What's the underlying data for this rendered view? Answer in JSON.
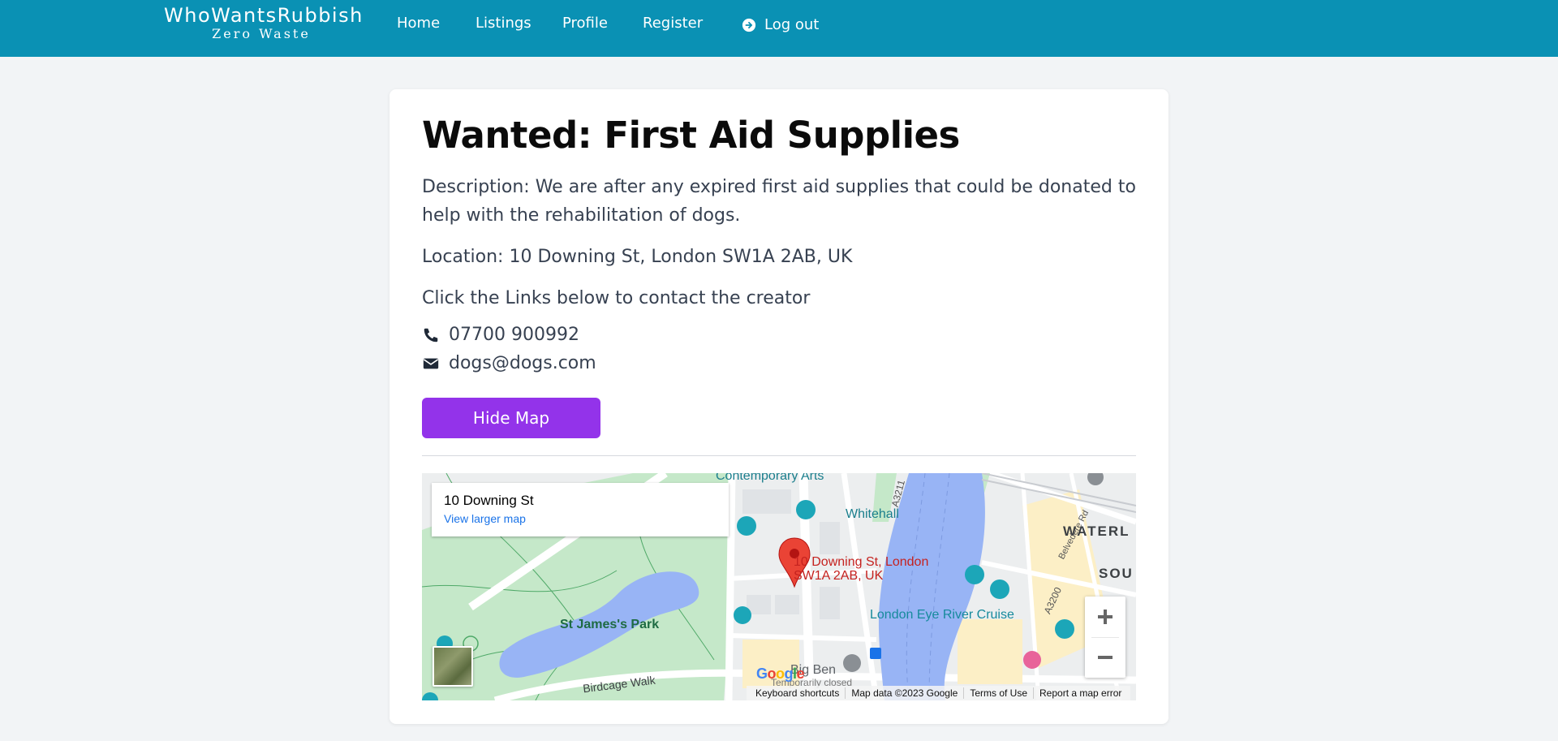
{
  "brand": {
    "name": "WhoWantsRubbish",
    "tagline": "Zero Waste"
  },
  "nav": {
    "home": "Home",
    "listings": "Listings",
    "profile": "Profile",
    "register": "Register",
    "logout": "Log out"
  },
  "listing": {
    "title": "Wanted: First Aid Supplies",
    "description": "Description: We are after any expired first aid supplies that could be donated to help with the rehabilitation of dogs.",
    "location": "Location: 10 Downing St, London SW1A 2AB, UK",
    "contact_hint": "Click the Links below to contact the creator",
    "phone": "07700 900992",
    "email": "dogs@dogs.com",
    "hide_map_label": "Hide Map"
  },
  "map": {
    "info_title": "10 Downing St",
    "info_link": "View larger map",
    "pin_label_line1": "10 Downing St, London",
    "pin_label_line2": "SW1A 2AB, UK",
    "labels": {
      "park": "St James's Park",
      "cruise": "London Eye River Cruise",
      "whitehall": "Whitehall",
      "arts": "Contemporary Arts",
      "big_ben": "Big Ben",
      "closed": "Temporarily closed",
      "birdcage": "Birdcage Walk",
      "waterloo": "WATERL",
      "sou": "SOU",
      "road_a3211": "A3211",
      "road_a3200": "A3200",
      "road_belvedere": "Belvedere Rd"
    },
    "google": "Google",
    "attribution": {
      "shortcuts": "Keyboard shortcuts",
      "data": "Map data ©2023 Google",
      "terms": "Terms of Use",
      "report": "Report a map error"
    },
    "colors": {
      "water": "#98b4f5",
      "park": "#c5e8c9",
      "road": "#ffffff",
      "land": "#eceeef",
      "pin": "#ea4335"
    }
  },
  "colors": {
    "navbar": "#0a91b4",
    "button": "#9333ea",
    "page_bg": "#f2f4f6"
  },
  "icons": {
    "logout": "arrow-circle-right-icon",
    "phone": "phone-icon",
    "email": "envelope-icon"
  }
}
